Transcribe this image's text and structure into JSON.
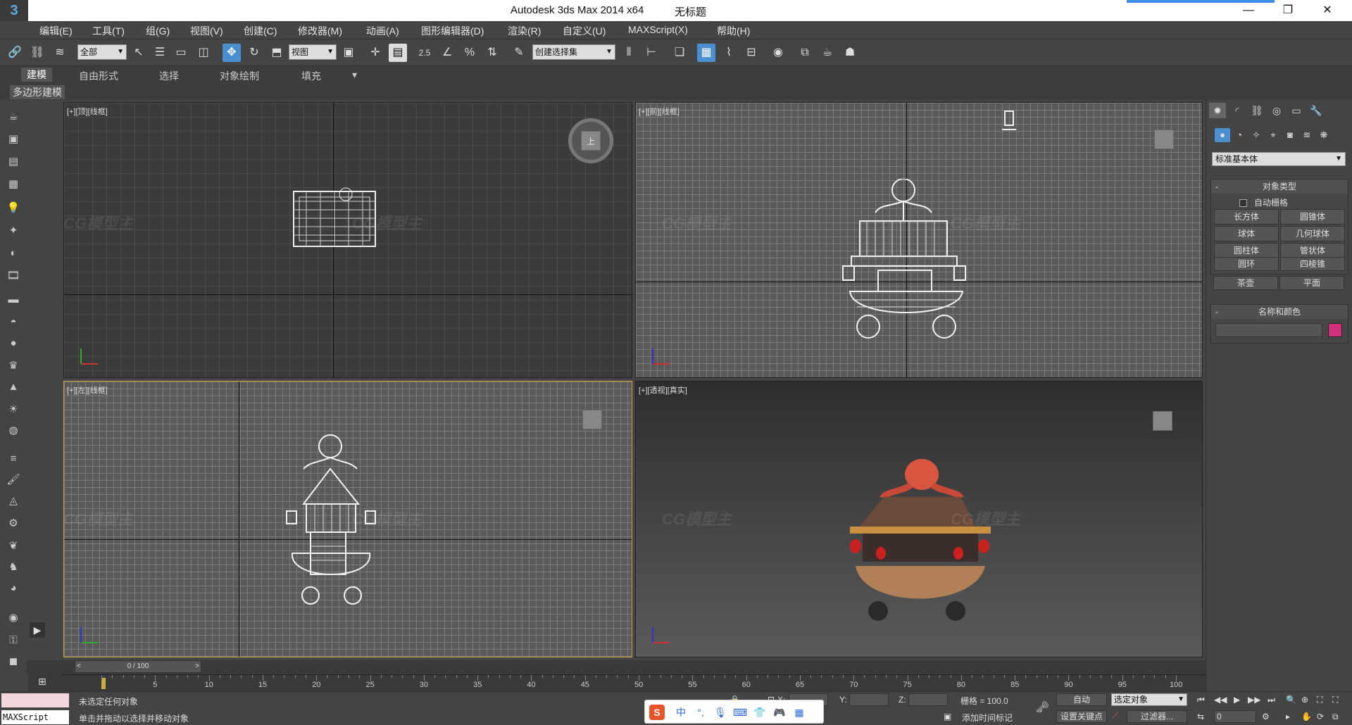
{
  "titlebar": {
    "app_title": "Autodesk 3ds Max  2014 x64",
    "document": "无标题",
    "minimize": "—",
    "restore": "❐",
    "close": "✕"
  },
  "menu": [
    "编辑(E)",
    "工具(T)",
    "组(G)",
    "视图(V)",
    "创建(C)",
    "修改器(M)",
    "动画(A)",
    "图形编辑器(D)",
    "渲染(R)",
    "自定义(U)",
    "MAXScript(X)",
    "帮助(H)"
  ],
  "toolbar": {
    "selection_filter": "全部",
    "ref_coord": "视图",
    "snap_value": "2.5",
    "named_selection": "创建选择集"
  },
  "ribbon": {
    "tabs": [
      "建模",
      "自由形式",
      "选择",
      "对象绘制",
      "填充"
    ],
    "active_tab": "建模",
    "sub_label": "多边形建模"
  },
  "viewports": {
    "top": "[+][顶][线框]",
    "front": "[+][前][线框]",
    "left": "[+][左][线框]",
    "perspective": "[+][透视][真实]",
    "top_cube_label": "上"
  },
  "command_panel": {
    "dropdown": "标准基本体",
    "object_type_title": "对象类型",
    "autogrid": "自动栅格",
    "buttons": [
      "长方体",
      "圆锥体",
      "球体",
      "几何球体",
      "圆柱体",
      "管状体",
      "圆环",
      "四棱锥",
      "茶壶",
      "平面"
    ],
    "name_color_title": "名称和颜色",
    "color": "#d0307a"
  },
  "timeline": {
    "frame_counter": "0 / 100",
    "ticks": [
      "5",
      "10",
      "15",
      "20",
      "25",
      "30",
      "35",
      "40",
      "45",
      "50",
      "55",
      "60",
      "65",
      "70",
      "75",
      "80",
      "85",
      "90",
      "95",
      "100"
    ]
  },
  "status": {
    "maxscript": "MAXScript",
    "line1": "未选定任何对象",
    "line2": "单击并拖动以选择并移动对象",
    "x_label": "X:",
    "y_label": "Y:",
    "z_label": "Z:",
    "grid": "栅格 = 100.0",
    "add_time_tag": "添加时间标记",
    "auto": "自动",
    "selected_set": "选定对象",
    "set_key": "设置关键点",
    "filters": "过滤器...",
    "frame": "0"
  },
  "ime": {
    "logo": "S",
    "mode": "中"
  },
  "watermark": "CG模型主"
}
